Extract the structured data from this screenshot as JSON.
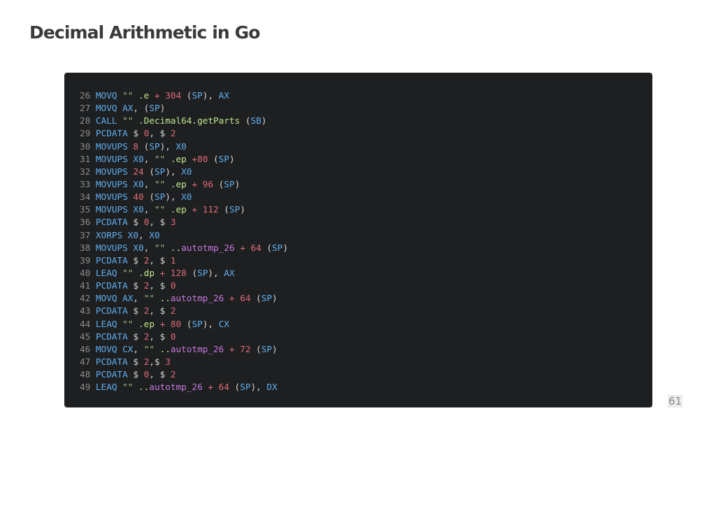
{
  "slide": {
    "title": "Decimal Arithmetic in Go",
    "page_number": "61"
  },
  "colors": {
    "background": "#ffffff",
    "code_background": "#1d1f21",
    "line_number": "#8d8d8d",
    "instruction": "#61afef",
    "number": "#e06c75",
    "symbol": "#c3e88d",
    "autotmp": "#c678dd",
    "punctuation": "#d6d6d6"
  },
  "code": {
    "lines": [
      {
        "n": "26",
        "tokens": [
          [
            "kw",
            "MOVQ"
          ],
          [
            "p",
            " "
          ],
          [
            "str",
            "\"\""
          ],
          [
            "p",
            " "
          ],
          [
            "field",
            ".e"
          ],
          [
            "p",
            " "
          ],
          [
            "op",
            "+"
          ],
          [
            "p",
            " "
          ],
          [
            "num",
            "304"
          ],
          [
            "p",
            " ("
          ],
          [
            "reg",
            "SP"
          ],
          [
            "p",
            "), "
          ],
          [
            "reg",
            "AX"
          ]
        ]
      },
      {
        "n": "27",
        "tokens": [
          [
            "kw",
            "MOVQ"
          ],
          [
            "p",
            " "
          ],
          [
            "reg",
            "AX"
          ],
          [
            "p",
            ", ("
          ],
          [
            "reg",
            "SP"
          ],
          [
            "p",
            ")"
          ]
        ]
      },
      {
        "n": "28",
        "tokens": [
          [
            "kw",
            "CALL"
          ],
          [
            "p",
            " "
          ],
          [
            "str",
            "\"\""
          ],
          [
            "p",
            " "
          ],
          [
            "field",
            ".Decimal64.getParts"
          ],
          [
            "p",
            " ("
          ],
          [
            "reg",
            "SB"
          ],
          [
            "p",
            ")"
          ]
        ]
      },
      {
        "n": "29",
        "tokens": [
          [
            "kw",
            "PCDATA"
          ],
          [
            "p",
            " $ "
          ],
          [
            "num",
            "0"
          ],
          [
            "p",
            ", $ "
          ],
          [
            "num",
            "2"
          ]
        ]
      },
      {
        "n": "30",
        "tokens": [
          [
            "kw",
            "MOVUPS"
          ],
          [
            "p",
            " "
          ],
          [
            "num",
            "8"
          ],
          [
            "p",
            " ("
          ],
          [
            "reg",
            "SP"
          ],
          [
            "p",
            "), "
          ],
          [
            "reg",
            "X0"
          ]
        ]
      },
      {
        "n": "31",
        "tokens": [
          [
            "kw",
            "MOVUPS"
          ],
          [
            "p",
            " "
          ],
          [
            "reg",
            "X0"
          ],
          [
            "p",
            ", "
          ],
          [
            "str",
            "\"\""
          ],
          [
            "p",
            " "
          ],
          [
            "field",
            ".ep"
          ],
          [
            "p",
            " "
          ],
          [
            "op",
            "+"
          ],
          [
            "num",
            "80"
          ],
          [
            "p",
            " ("
          ],
          [
            "reg",
            "SP"
          ],
          [
            "p",
            ")"
          ]
        ]
      },
      {
        "n": "32",
        "tokens": [
          [
            "kw",
            "MOVUPS"
          ],
          [
            "p",
            " "
          ],
          [
            "num",
            "24"
          ],
          [
            "p",
            " ("
          ],
          [
            "reg",
            "SP"
          ],
          [
            "p",
            "), "
          ],
          [
            "reg",
            "X0"
          ]
        ]
      },
      {
        "n": "33",
        "tokens": [
          [
            "kw",
            "MOVUPS"
          ],
          [
            "p",
            " "
          ],
          [
            "reg",
            "X0"
          ],
          [
            "p",
            ", "
          ],
          [
            "str",
            "\"\""
          ],
          [
            "p",
            " "
          ],
          [
            "field",
            ".ep"
          ],
          [
            "p",
            " "
          ],
          [
            "op",
            "+"
          ],
          [
            "p",
            " "
          ],
          [
            "num",
            "96"
          ],
          [
            "p",
            " ("
          ],
          [
            "reg",
            "SP"
          ],
          [
            "p",
            ")"
          ]
        ]
      },
      {
        "n": "34",
        "tokens": [
          [
            "kw",
            "MOVUPS"
          ],
          [
            "p",
            " "
          ],
          [
            "num",
            "40"
          ],
          [
            "p",
            " ("
          ],
          [
            "reg",
            "SP"
          ],
          [
            "p",
            "), "
          ],
          [
            "reg",
            "X0"
          ]
        ]
      },
      {
        "n": "35",
        "tokens": [
          [
            "kw",
            "MOVUPS"
          ],
          [
            "p",
            " "
          ],
          [
            "reg",
            "X0"
          ],
          [
            "p",
            ", "
          ],
          [
            "str",
            "\"\""
          ],
          [
            "p",
            " "
          ],
          [
            "field",
            ".ep"
          ],
          [
            "p",
            " "
          ],
          [
            "op",
            "+"
          ],
          [
            "p",
            " "
          ],
          [
            "num",
            "112"
          ],
          [
            "p",
            " ("
          ],
          [
            "reg",
            "SP"
          ],
          [
            "p",
            ")"
          ]
        ]
      },
      {
        "n": "36",
        "tokens": [
          [
            "kw",
            "PCDATA"
          ],
          [
            "p",
            " $ "
          ],
          [
            "num",
            "0"
          ],
          [
            "p",
            ", $ "
          ],
          [
            "num",
            "3"
          ]
        ]
      },
      {
        "n": "37",
        "tokens": [
          [
            "kw",
            "XORPS"
          ],
          [
            "p",
            " "
          ],
          [
            "reg",
            "X0"
          ],
          [
            "p",
            ", "
          ],
          [
            "reg",
            "X0"
          ]
        ]
      },
      {
        "n": "38",
        "tokens": [
          [
            "kw",
            "MOVUPS"
          ],
          [
            "p",
            " "
          ],
          [
            "reg",
            "X0"
          ],
          [
            "p",
            ", "
          ],
          [
            "str",
            "\"\""
          ],
          [
            "p",
            " "
          ],
          [
            "field",
            ".."
          ],
          [
            "auto",
            "autotmp_26"
          ],
          [
            "p",
            " "
          ],
          [
            "op",
            "+"
          ],
          [
            "p",
            " "
          ],
          [
            "num",
            "64"
          ],
          [
            "p",
            " ("
          ],
          [
            "reg",
            "SP"
          ],
          [
            "p",
            ")"
          ]
        ]
      },
      {
        "n": "39",
        "tokens": [
          [
            "kw",
            "PCDATA"
          ],
          [
            "p",
            " $ "
          ],
          [
            "num",
            "2"
          ],
          [
            "p",
            ", $ "
          ],
          [
            "num",
            "1"
          ]
        ]
      },
      {
        "n": "40",
        "tokens": [
          [
            "kw",
            "LEAQ"
          ],
          [
            "p",
            " "
          ],
          [
            "str",
            "\"\""
          ],
          [
            "p",
            " "
          ],
          [
            "field",
            ".dp"
          ],
          [
            "p",
            " "
          ],
          [
            "op",
            "+"
          ],
          [
            "p",
            " "
          ],
          [
            "num",
            "128"
          ],
          [
            "p",
            " ("
          ],
          [
            "reg",
            "SP"
          ],
          [
            "p",
            "), "
          ],
          [
            "reg",
            "AX"
          ]
        ]
      },
      {
        "n": "41",
        "tokens": [
          [
            "kw",
            "PCDATA"
          ],
          [
            "p",
            " $ "
          ],
          [
            "num",
            "2"
          ],
          [
            "p",
            ", $ "
          ],
          [
            "num",
            "0"
          ]
        ]
      },
      {
        "n": "42",
        "tokens": [
          [
            "kw",
            "MOVQ"
          ],
          [
            "p",
            " "
          ],
          [
            "reg",
            "AX"
          ],
          [
            "p",
            ", "
          ],
          [
            "str",
            "\"\""
          ],
          [
            "p",
            " "
          ],
          [
            "field",
            ".."
          ],
          [
            "auto",
            "autotmp_26"
          ],
          [
            "p",
            " "
          ],
          [
            "op",
            "+"
          ],
          [
            "p",
            " "
          ],
          [
            "num",
            "64"
          ],
          [
            "p",
            " ("
          ],
          [
            "reg",
            "SP"
          ],
          [
            "p",
            ")"
          ]
        ]
      },
      {
        "n": "43",
        "tokens": [
          [
            "kw",
            "PCDATA"
          ],
          [
            "p",
            " $ "
          ],
          [
            "num",
            "2"
          ],
          [
            "p",
            ", $ "
          ],
          [
            "num",
            "2"
          ]
        ]
      },
      {
        "n": "44",
        "tokens": [
          [
            "kw",
            "LEAQ"
          ],
          [
            "p",
            " "
          ],
          [
            "str",
            "\"\""
          ],
          [
            "p",
            " "
          ],
          [
            "field",
            ".ep"
          ],
          [
            "p",
            " "
          ],
          [
            "op",
            "+"
          ],
          [
            "p",
            " "
          ],
          [
            "num",
            "80"
          ],
          [
            "p",
            " ("
          ],
          [
            "reg",
            "SP"
          ],
          [
            "p",
            "), "
          ],
          [
            "reg",
            "CX"
          ]
        ]
      },
      {
        "n": "45",
        "tokens": [
          [
            "kw",
            "PCDATA"
          ],
          [
            "p",
            " $ "
          ],
          [
            "num",
            "2"
          ],
          [
            "p",
            ", $ "
          ],
          [
            "num",
            "0"
          ]
        ]
      },
      {
        "n": "46",
        "tokens": [
          [
            "kw",
            "MOVQ"
          ],
          [
            "p",
            " "
          ],
          [
            "reg",
            "CX"
          ],
          [
            "p",
            ", "
          ],
          [
            "str",
            "\"\""
          ],
          [
            "p",
            " "
          ],
          [
            "field",
            ".."
          ],
          [
            "auto",
            "autotmp_26"
          ],
          [
            "p",
            " "
          ],
          [
            "op",
            "+"
          ],
          [
            "p",
            " "
          ],
          [
            "num",
            "72"
          ],
          [
            "p",
            " ("
          ],
          [
            "reg",
            "SP"
          ],
          [
            "p",
            ")"
          ]
        ]
      },
      {
        "n": "47",
        "tokens": [
          [
            "kw",
            "PCDATA"
          ],
          [
            "p",
            " $ "
          ],
          [
            "num",
            "2"
          ],
          [
            "p",
            ",$ "
          ],
          [
            "num",
            "3"
          ]
        ]
      },
      {
        "n": "48",
        "tokens": [
          [
            "kw",
            "PCDATA"
          ],
          [
            "p",
            " $ "
          ],
          [
            "num",
            "0"
          ],
          [
            "p",
            ", $ "
          ],
          [
            "num",
            "2"
          ]
        ]
      },
      {
        "n": "49",
        "tokens": [
          [
            "kw",
            "LEAQ"
          ],
          [
            "p",
            " "
          ],
          [
            "str",
            "\"\""
          ],
          [
            "p",
            " "
          ],
          [
            "field",
            ".."
          ],
          [
            "auto",
            "autotmp_26"
          ],
          [
            "p",
            " "
          ],
          [
            "op",
            "+"
          ],
          [
            "p",
            " "
          ],
          [
            "num",
            "64"
          ],
          [
            "p",
            " ("
          ],
          [
            "reg",
            "SP"
          ],
          [
            "p",
            "), "
          ],
          [
            "reg",
            "DX"
          ]
        ]
      }
    ]
  }
}
